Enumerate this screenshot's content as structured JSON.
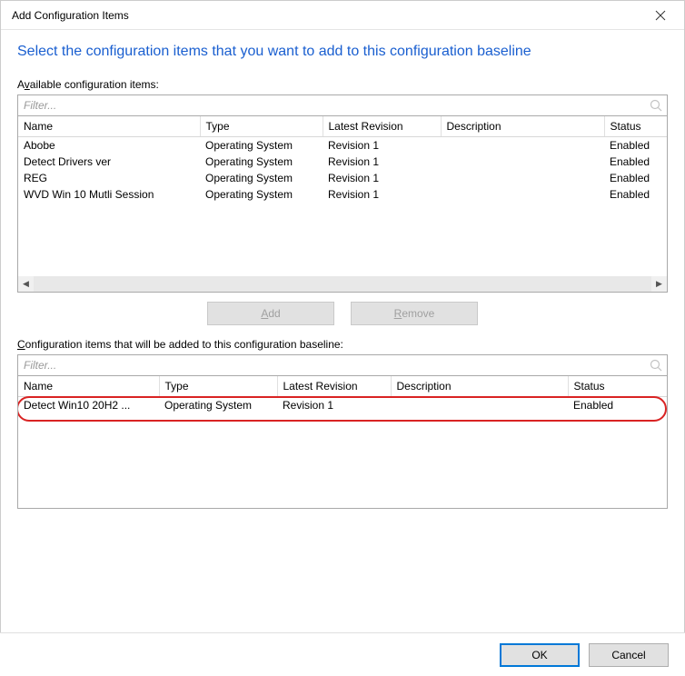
{
  "window": {
    "title": "Add Configuration Items"
  },
  "headline": "Select the configuration items that you want to add to this configuration baseline",
  "available": {
    "label_pre": "A",
    "label_u": "v",
    "label_post": "ailable configuration items:",
    "filter_placeholder": "Filter..."
  },
  "columns": {
    "name": "Name",
    "type": "Type",
    "latest": "Latest Revision",
    "description": "Description",
    "status": "Status"
  },
  "available_items": [
    {
      "name": "Abobe",
      "type": "Operating System",
      "latest": "Revision 1",
      "description": "",
      "status": "Enabled"
    },
    {
      "name": "Detect Drivers ver",
      "type": "Operating System",
      "latest": "Revision 1",
      "description": "",
      "status": "Enabled"
    },
    {
      "name": "REG",
      "type": "Operating System",
      "latest": "Revision 1",
      "description": "",
      "status": "Enabled"
    },
    {
      "name": "WVD Win 10 Mutli Session",
      "type": "Operating System",
      "latest": "Revision 1",
      "description": "",
      "status": "Enabled"
    }
  ],
  "buttons": {
    "add_u": "A",
    "add_rest": "dd",
    "remove_u": "R",
    "remove_rest": "emove"
  },
  "added": {
    "label_u": "C",
    "label_post": "onfiguration items that will be added to this configuration baseline:",
    "filter_placeholder": "Filter..."
  },
  "added_items": [
    {
      "name": "Detect Win10 20H2 ...",
      "type": "Operating System",
      "latest": "Revision 1",
      "description": "",
      "status": "Enabled"
    }
  ],
  "footer": {
    "ok": "OK",
    "cancel": "Cancel"
  }
}
